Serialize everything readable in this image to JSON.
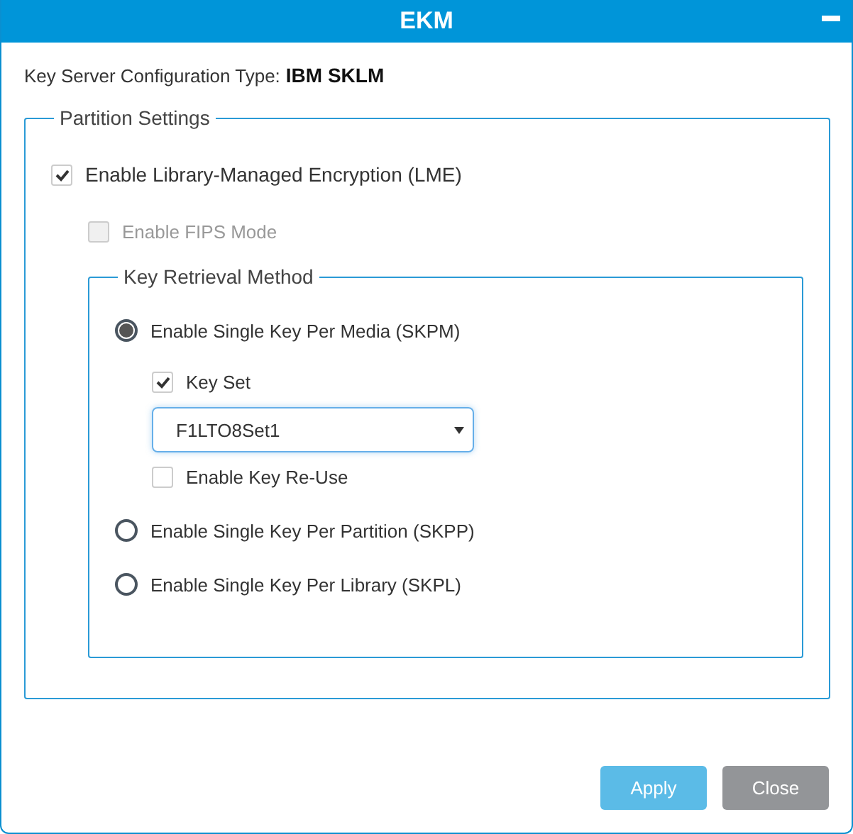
{
  "window": {
    "title": "EKM"
  },
  "config": {
    "label": "Key Server Configuration Type:",
    "value": "IBM SKLM"
  },
  "partition_settings": {
    "legend": "Partition Settings",
    "options": [
      {
        "label": "Enable Library-Managed Encryption (LME)",
        "checked": true,
        "disabled": false
      },
      {
        "label": "Enable FIPS Mode",
        "checked": false,
        "disabled": true
      }
    ],
    "key_retrieval": {
      "legend": "Key Retrieval Method",
      "methods": [
        {
          "label": "Enable Single Key Per Media (SKPM)",
          "selected": true,
          "options": [
            {
              "kind": "checkbox",
              "label": "Key Set",
              "checked": true
            },
            {
              "kind": "select",
              "value": "F1LTO8Set1"
            },
            {
              "kind": "checkbox",
              "label": "Enable Key Re-Use",
              "checked": false
            }
          ]
        },
        {
          "label": "Enable Single Key Per Partition (SKPP)",
          "selected": false
        },
        {
          "label": "Enable Single Key Per Library (SKPL)",
          "selected": false
        }
      ]
    }
  },
  "buttons": [
    {
      "label": "Apply",
      "kind": "primary"
    },
    {
      "label": "Close",
      "kind": "secondary"
    }
  ]
}
